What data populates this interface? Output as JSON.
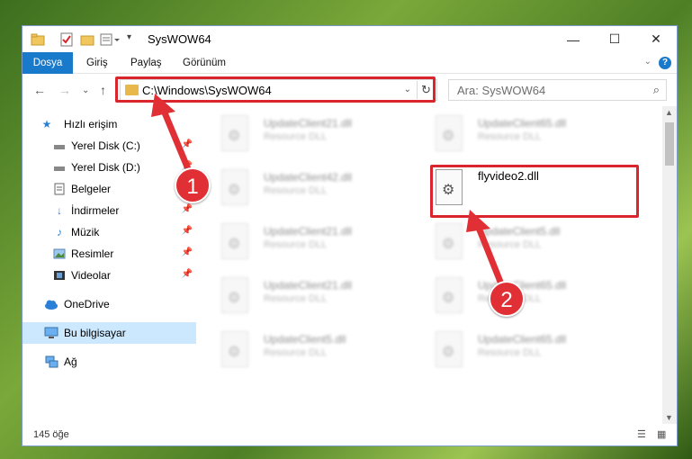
{
  "window": {
    "title": "SysWOW64"
  },
  "titlebar": {
    "quick_access_icons": [
      "folder-icon",
      "properties-check-icon",
      "new-folder-icon",
      "customize-icon"
    ],
    "minimize": "—",
    "maximize": "☐",
    "close": "✕"
  },
  "ribbon": {
    "tabs": [
      "Dosya",
      "Giriş",
      "Paylaş",
      "Görünüm"
    ],
    "help": "?"
  },
  "address": {
    "path": "C:\\Windows\\SysWOW64",
    "refresh": "↻"
  },
  "search": {
    "placeholder": "Ara: SysWOW64"
  },
  "sidebar": {
    "items": [
      {
        "label": "Hızlı erişim",
        "icon": "star-icon",
        "pinned": false
      },
      {
        "label": "Yerel Disk (C:)",
        "icon": "drive-icon",
        "pinned": true
      },
      {
        "label": "Yerel Disk (D:)",
        "icon": "drive-icon",
        "pinned": true
      },
      {
        "label": "Belgeler",
        "icon": "document-icon",
        "pinned": true
      },
      {
        "label": "İndirmeler",
        "icon": "download-icon",
        "pinned": true
      },
      {
        "label": "Müzik",
        "icon": "music-icon",
        "pinned": true
      },
      {
        "label": "Resimler",
        "icon": "picture-icon",
        "pinned": true
      },
      {
        "label": "Videolar",
        "icon": "video-icon",
        "pinned": true
      },
      {
        "label": "OneDrive",
        "icon": "cloud-icon",
        "pinned": false
      },
      {
        "label": "Bu bilgisayar",
        "icon": "computer-icon",
        "pinned": false,
        "selected": true
      },
      {
        "label": "Ağ",
        "icon": "network-icon",
        "pinned": false
      }
    ]
  },
  "files": [
    {
      "name": "UpdateClient21.dll",
      "type": "Resource DLL"
    },
    {
      "name": "UpdateClient65.dll",
      "type": "Resource DLL"
    },
    {
      "name": "UpdateClient42.dll",
      "type": "Resource DLL"
    },
    {
      "name": "flyvideo2.dll",
      "type": ""
    },
    {
      "name": "UpdateClient21.dll",
      "type": "Resource DLL"
    },
    {
      "name": "UpdateClient5.dll",
      "type": "Resource DLL"
    },
    {
      "name": "UpdateClient21.dll",
      "type": "Resource DLL"
    },
    {
      "name": "UpdateClient65.dll",
      "type": "Resource DLL"
    },
    {
      "name": "UpdateClient5.dll",
      "type": "Resource DLL"
    },
    {
      "name": "UpdateClient65.dll",
      "type": "Resource DLL"
    }
  ],
  "status": {
    "count": "145 öğe"
  },
  "annotations": {
    "badge1": "1",
    "badge2": "2",
    "highlight_color": "#d9262c"
  }
}
